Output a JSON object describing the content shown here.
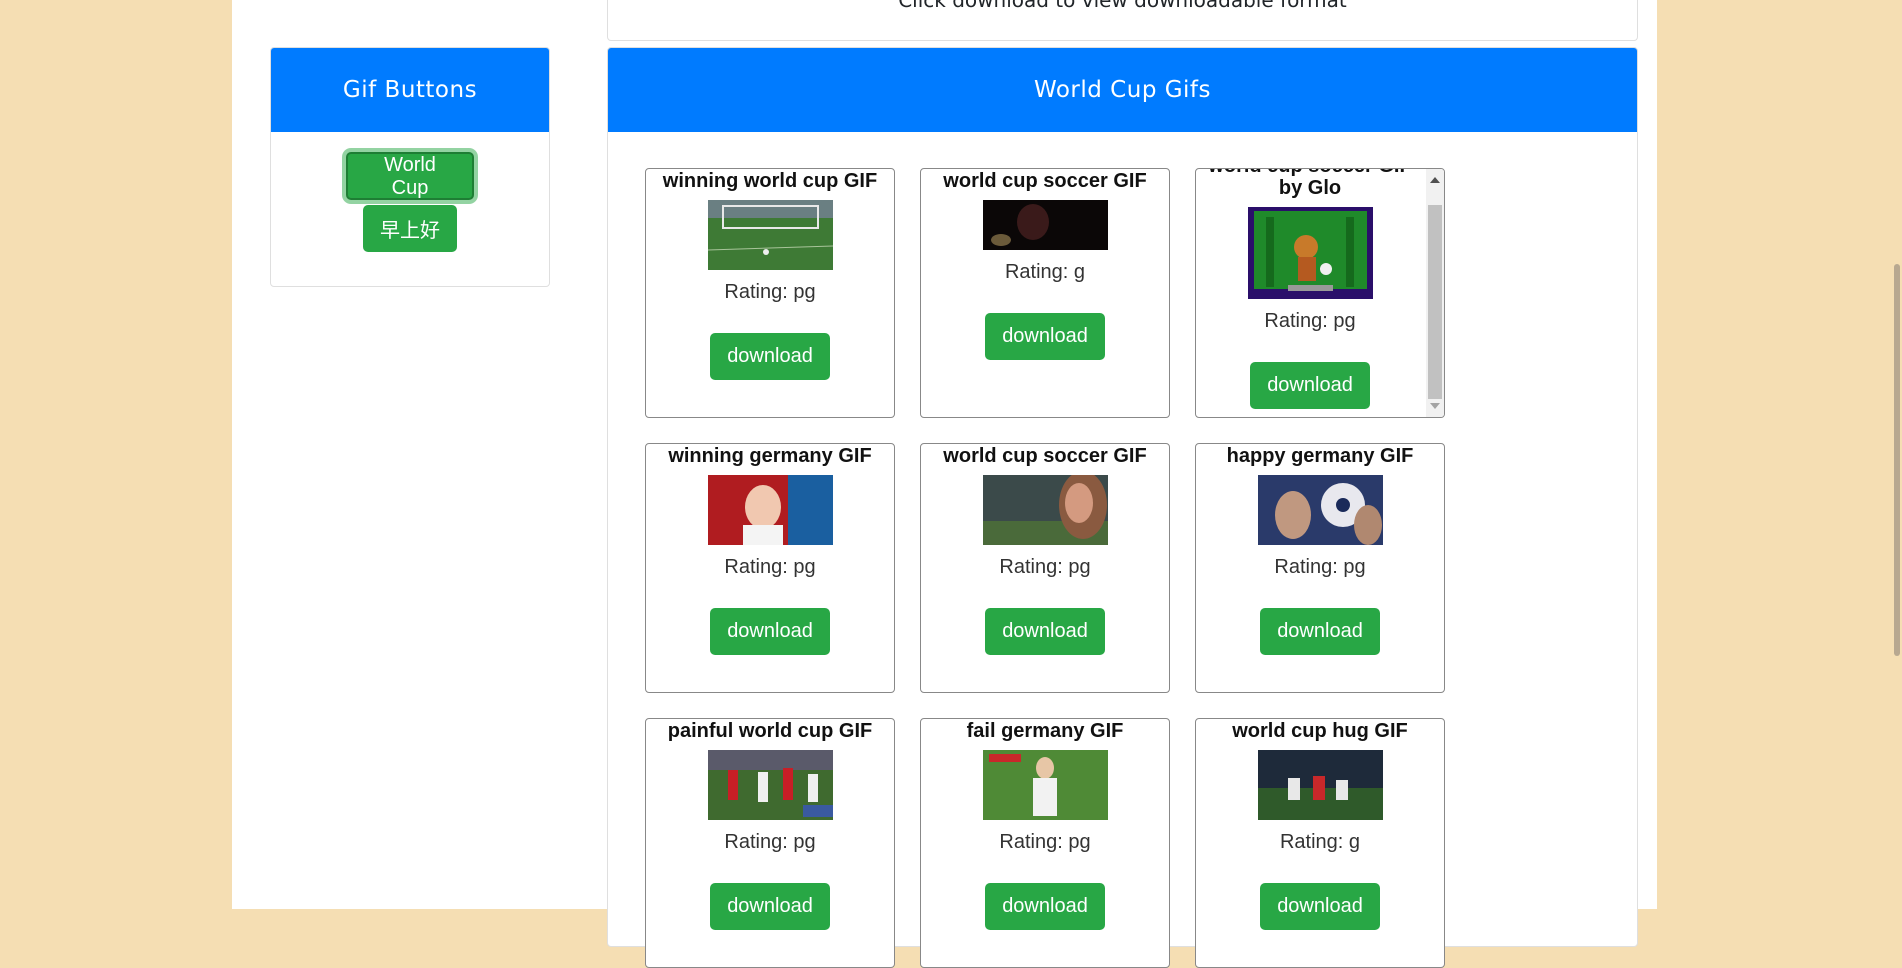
{
  "instruction": "Click download to view downloadable format",
  "sidebar": {
    "title": "Gif Buttons",
    "buttons": [
      "World Cup",
      "早上好"
    ]
  },
  "main": {
    "title": "World Cup Gifs",
    "gifs": [
      {
        "title": "winning world cup GIF",
        "rating": "Rating: pg",
        "download": "download"
      },
      {
        "title": "world cup soccer GIF",
        "rating": "Rating: g",
        "download": "download"
      },
      {
        "title": "world cup soccer GIF by Glo",
        "rating": "Rating: pg",
        "download": "download"
      },
      {
        "title": "winning germany GIF",
        "rating": "Rating: pg",
        "download": "download"
      },
      {
        "title": "world cup soccer GIF",
        "rating": "Rating: pg",
        "download": "download"
      },
      {
        "title": "happy germany GIF",
        "rating": "Rating: pg",
        "download": "download"
      },
      {
        "title": "painful world cup GIF",
        "rating": "Rating: pg",
        "download": "download"
      },
      {
        "title": "fail germany GIF",
        "rating": "Rating: pg",
        "download": "download"
      },
      {
        "title": "world cup hug GIF",
        "rating": "Rating: g",
        "download": "download"
      }
    ]
  },
  "colors": {
    "background": "#f5deb3",
    "header": "#007bff",
    "button": "#28a745"
  }
}
